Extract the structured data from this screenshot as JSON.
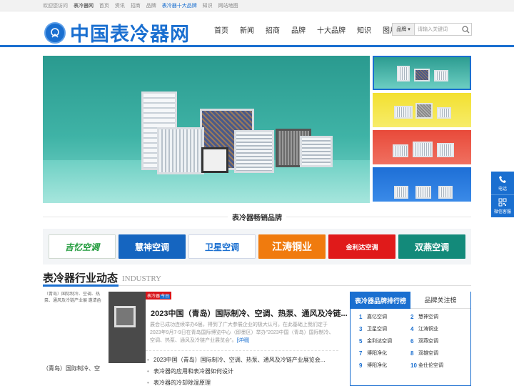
{
  "topbar": {
    "welcome": "欢迎您访问",
    "site": "表冷器网",
    "links": [
      "首页",
      "资讯",
      "招商",
      "品牌"
    ],
    "highlight": "表冷器十大品牌",
    "links2": [
      "知识",
      "网站地图"
    ]
  },
  "header": {
    "logo_badge": "中国表冷器",
    "logo_text": "中国表冷器网",
    "nav": [
      "首页",
      "新闻",
      "招商",
      "品牌",
      "十大品牌",
      "知识",
      "图片"
    ]
  },
  "search": {
    "select_value": "品牌",
    "placeholder": "请输入关键词",
    "icon": "search-icon"
  },
  "hot_brands": {
    "title": "表冷器畅销品牌",
    "items": [
      {
        "name": "吉忆空调",
        "color": "#1f9a3a"
      },
      {
        "name": "慧神空调",
        "color": "#1565c0"
      },
      {
        "name": "卫星空调",
        "color": "#1a6fd0"
      },
      {
        "name": "江涛铜业",
        "color": "#f07b0e"
      },
      {
        "name": "金利达空调",
        "color": "#e01a1a"
      },
      {
        "name": "双燕空调",
        "color": "#138a7a"
      }
    ]
  },
  "industry": {
    "title_cn": "表冷器行业动态",
    "title_en": "INDUSTRY",
    "image_text": "（青岛）国际制冷、空调、热泵、通风及冷链产业展 邀请函",
    "image_caption_lines": [
      "（青岛）国际制冷、空",
      "调、热泵、通风及冷链产业展...",
      "表冷器的"
    ],
    "tag_left": "表冷器",
    "tag_right": "今日",
    "headline": "2023中国（青岛）国际制冷、空调、热泵、通风及冷链...",
    "summary": "展会已成功连续举办6届，得到了广大参展企业的极大认可。在此基础上我们定于2023年9月7-9日在青岛国际博览中心（即墨区）举办\"2023中国（青岛）国际制冷、空调、热泵、通风及冷链产业展览会\"。",
    "more": "[详细]",
    "list": [
      "2023中国（青岛）国际制冷、空调、热泵、通风及冷链产业展览会...",
      "表冷器的应用和表冷器如何设计",
      "表冷器的冷却除湿原理"
    ]
  },
  "ranking": {
    "tab_active": "表冷器品牌排行榜",
    "tab_other": "品牌关注榜",
    "items": [
      {
        "no": "1",
        "name": "嘉亿空调"
      },
      {
        "no": "2",
        "name": "慧神空调"
      },
      {
        "no": "3",
        "name": "卫星空调"
      },
      {
        "no": "4",
        "name": "江涛铜业"
      },
      {
        "no": "5",
        "name": "金利达空调"
      },
      {
        "no": "6",
        "name": "双燕空调"
      },
      {
        "no": "7",
        "name": "博阳净化"
      },
      {
        "no": "8",
        "name": "双雄空调"
      },
      {
        "no": "9",
        "name": "博阳净化"
      },
      {
        "no": "10",
        "name": "金仕伦空调"
      }
    ]
  },
  "float": {
    "phone_label": "电话",
    "wechat_label": "微信客服"
  }
}
